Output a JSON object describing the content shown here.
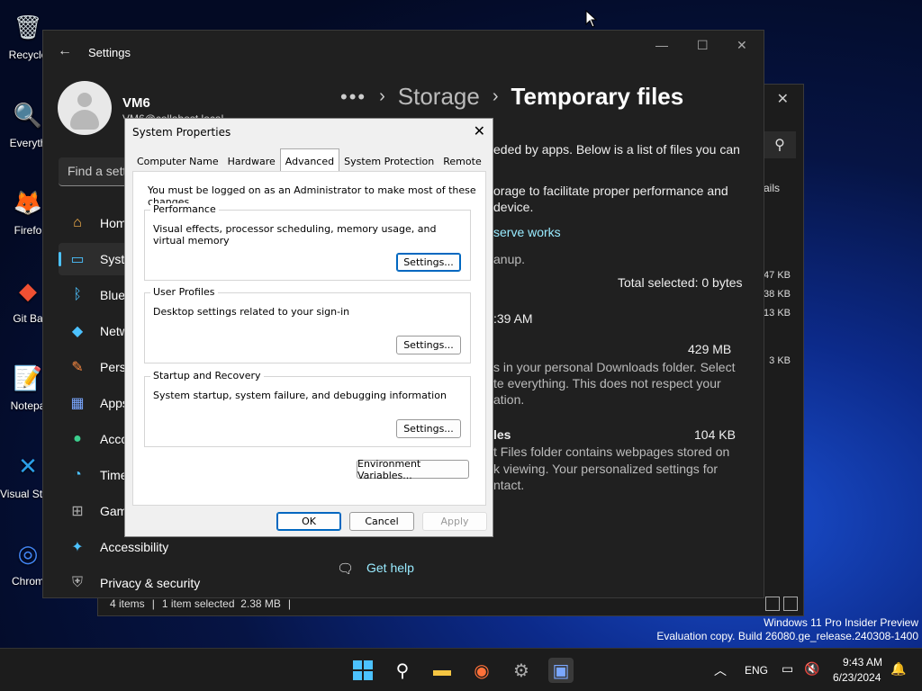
{
  "desktop": {
    "icons": [
      {
        "label": "Recycle",
        "glyph": "🗑",
        "color": "#cfd8dc"
      },
      {
        "label": "Everyth",
        "glyph": "🔍",
        "color": "#ff8c00"
      },
      {
        "label": "Firefo",
        "glyph": "🦊",
        "color": "#ff7139"
      },
      {
        "label": "Git Ba",
        "glyph": "◆",
        "color": "#f05033"
      },
      {
        "label": "Notepa",
        "glyph": "📝",
        "color": "#7cb342"
      },
      {
        "label": "Visual St Cod",
        "glyph": "✕",
        "color": "#2b9fe8"
      },
      {
        "label": "Chrom",
        "glyph": "◎",
        "color": "#4285f4"
      }
    ]
  },
  "explorer": {
    "details_label": "ails",
    "sizes": [
      "47 KB",
      "38 KB",
      "13 KB",
      "3 KB"
    ],
    "status_items": "4 items",
    "status_selected": "1 item selected  2.38 MB"
  },
  "settings": {
    "window_title": "Settings",
    "profile": {
      "name": "VM6",
      "email": "VM6@collabost.local"
    },
    "search_placeholder": "Find a sett",
    "nav": [
      {
        "label": "Home",
        "icon": "home-icon",
        "glyph": "⌂",
        "color": "#ffb74d"
      },
      {
        "label": "System",
        "icon": "monitor-icon",
        "glyph": "▭",
        "color": "#4cc2ff",
        "selected": true
      },
      {
        "label": "Bluet",
        "icon": "bluetooth-icon",
        "glyph": "ᛒ",
        "color": "#4cc2ff"
      },
      {
        "label": "Netw",
        "icon": "wifi-icon",
        "glyph": "◆",
        "color": "#4cc2ff"
      },
      {
        "label": "Perso",
        "icon": "brush-icon",
        "glyph": "✎",
        "color": "#ff8c42"
      },
      {
        "label": "Apps",
        "icon": "apps-icon",
        "glyph": "▦",
        "color": "#7aa7ff"
      },
      {
        "label": "Acco",
        "icon": "account-icon",
        "glyph": "●",
        "color": "#3ccf8e"
      },
      {
        "label": "Time",
        "icon": "clock-icon",
        "glyph": "◔",
        "color": "#4cc2ff"
      },
      {
        "label": "Gam",
        "icon": "gamepad-icon",
        "glyph": "⊞",
        "color": "#aaaaaa"
      },
      {
        "label": "Accessibility",
        "icon": "accessibility-icon",
        "glyph": "✦",
        "color": "#4cc2ff"
      },
      {
        "label": "Privacy & security",
        "icon": "shield-icon",
        "glyph": "⛨",
        "color": "#aaaaaa"
      }
    ],
    "breadcrumb": {
      "more": "•••",
      "parent": "Storage",
      "current": "Temporary files"
    },
    "content": {
      "intro1": "eded by apps. Below is a list of files you can",
      "intro2": "orage to facilitate proper performance and",
      "intro3": "device.",
      "link": "serve works",
      "cleanup": "anup.",
      "total_selected": "Total selected: 0 bytes",
      "scan_time": ":39 AM",
      "downloads_size": "429 MB",
      "downloads_desc1": "s in your personal Downloads folder. Select",
      "downloads_desc2": "te everything. This does not respect your",
      "downloads_desc3": "ation.",
      "tif_title": "les",
      "tif_size": "104 KB",
      "tif_desc1": "t Files folder contains webpages stored on",
      "tif_desc2": "k viewing. Your personalized settings for",
      "tif_desc3": "ntact.",
      "get_help": "Get help"
    }
  },
  "dialog": {
    "title": "System Properties",
    "tabs": [
      "Computer Name",
      "Hardware",
      "Advanced",
      "System Protection",
      "Remote"
    ],
    "active_tab": "Advanced",
    "admin_note": "You must be logged on as an Administrator to make most of these changes.",
    "groups": [
      {
        "legend": "Performance",
        "desc": "Visual effects, processor scheduling, memory usage, and virtual memory",
        "button": "Settings..."
      },
      {
        "legend": "User Profiles",
        "desc": "Desktop settings related to your sign-in",
        "button": "Settings..."
      },
      {
        "legend": "Startup and Recovery",
        "desc": "System startup, system failure, and debugging information",
        "button": "Settings..."
      }
    ],
    "env_button": "Environment Variables...",
    "ok": "OK",
    "cancel": "Cancel",
    "apply": "Apply"
  },
  "watermark": {
    "line1": "Windows 11 Pro Insider Preview",
    "line2": "Evaluation copy. Build 26080.ge_release.240308-1400"
  },
  "taskbar": {
    "lang": "ENG",
    "time": "9:43 AM",
    "date": "6/23/2024"
  }
}
